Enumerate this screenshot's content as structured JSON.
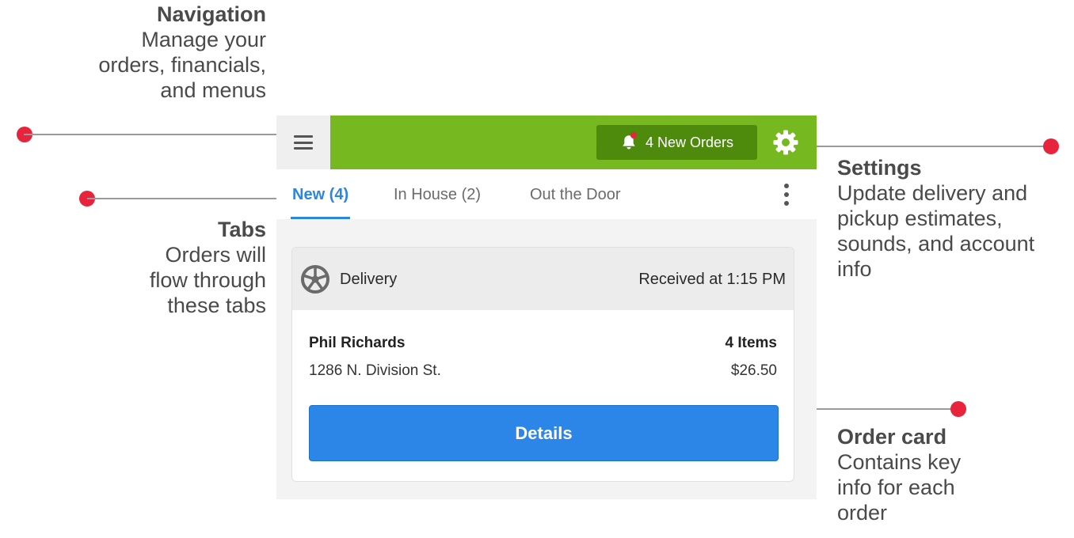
{
  "annotations": {
    "navigation": {
      "title": "Navigation",
      "lines": [
        "Manage your",
        "orders, financials,",
        "and menus"
      ]
    },
    "tabs": {
      "title": "Tabs",
      "lines": [
        "Orders will",
        "flow through",
        "these tabs"
      ]
    },
    "settings": {
      "title": "Settings",
      "lines": [
        "Update delivery and",
        "pickup estimates,",
        "sounds, and account",
        "info"
      ]
    },
    "order_card": {
      "title": "Order card",
      "lines": [
        "Contains key",
        "info for each",
        "order"
      ]
    }
  },
  "header": {
    "menu_icon": "hamburger-menu-icon",
    "new_orders_label": "4 New Orders",
    "bell_icon": "bell-icon",
    "settings_icon": "gear-icon",
    "bar_color": "#76b820",
    "button_color": "#4e8a0c"
  },
  "tabs": [
    {
      "label": "New (4)",
      "active": true
    },
    {
      "label": "In House (2)",
      "active": false
    },
    {
      "label": "Out the Door",
      "active": false
    }
  ],
  "order": {
    "type": "Delivery",
    "type_icon": "wheel-icon",
    "received": "Received at 1:15 PM",
    "customer": "Phil Richards",
    "items": "4 Items",
    "address": "1286 N. Division St.",
    "total": "$26.50",
    "details_label": "Details"
  },
  "colors": {
    "accent_blue": "#2b86e8",
    "callout_dot": "#e8243c"
  }
}
